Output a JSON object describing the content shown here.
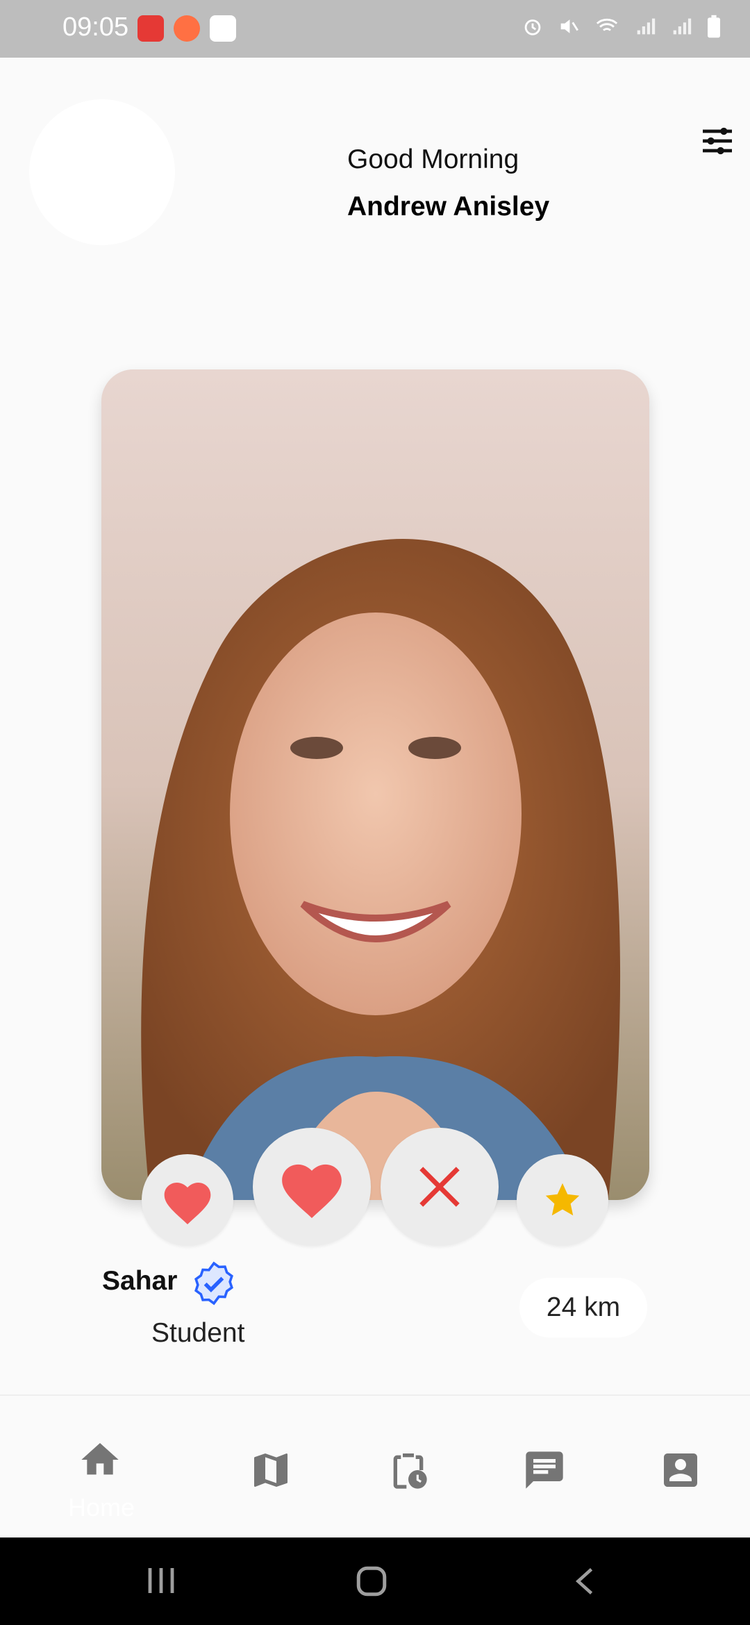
{
  "status": {
    "time": "09:05"
  },
  "header": {
    "greeting": "Good Morning",
    "username": "Andrew Anisley"
  },
  "profile": {
    "name": "Sahar",
    "occupation": "Student",
    "distance": "24 km"
  },
  "actions": [
    {
      "id": "like",
      "icon": "heart-icon",
      "color": "#f15b5b"
    },
    {
      "id": "super-like",
      "icon": "heart-icon",
      "color": "#f15b5b"
    },
    {
      "id": "dislike",
      "icon": "close-icon",
      "color": "#e53935"
    },
    {
      "id": "favorite",
      "icon": "star-icon",
      "color": "#f5b800"
    }
  ],
  "nav": {
    "items": [
      {
        "id": "home",
        "label": "Home",
        "icon": "home-icon",
        "active": true
      },
      {
        "id": "map",
        "label": "",
        "icon": "map-icon"
      },
      {
        "id": "schedule",
        "label": "",
        "icon": "clipboard-clock-icon"
      },
      {
        "id": "messages",
        "label": "",
        "icon": "chat-icon"
      },
      {
        "id": "profile",
        "label": "",
        "icon": "account-box-icon"
      }
    ]
  },
  "colors": {
    "accent": "#f15b5b",
    "verified": "#2962ff",
    "star": "#f5b800"
  }
}
